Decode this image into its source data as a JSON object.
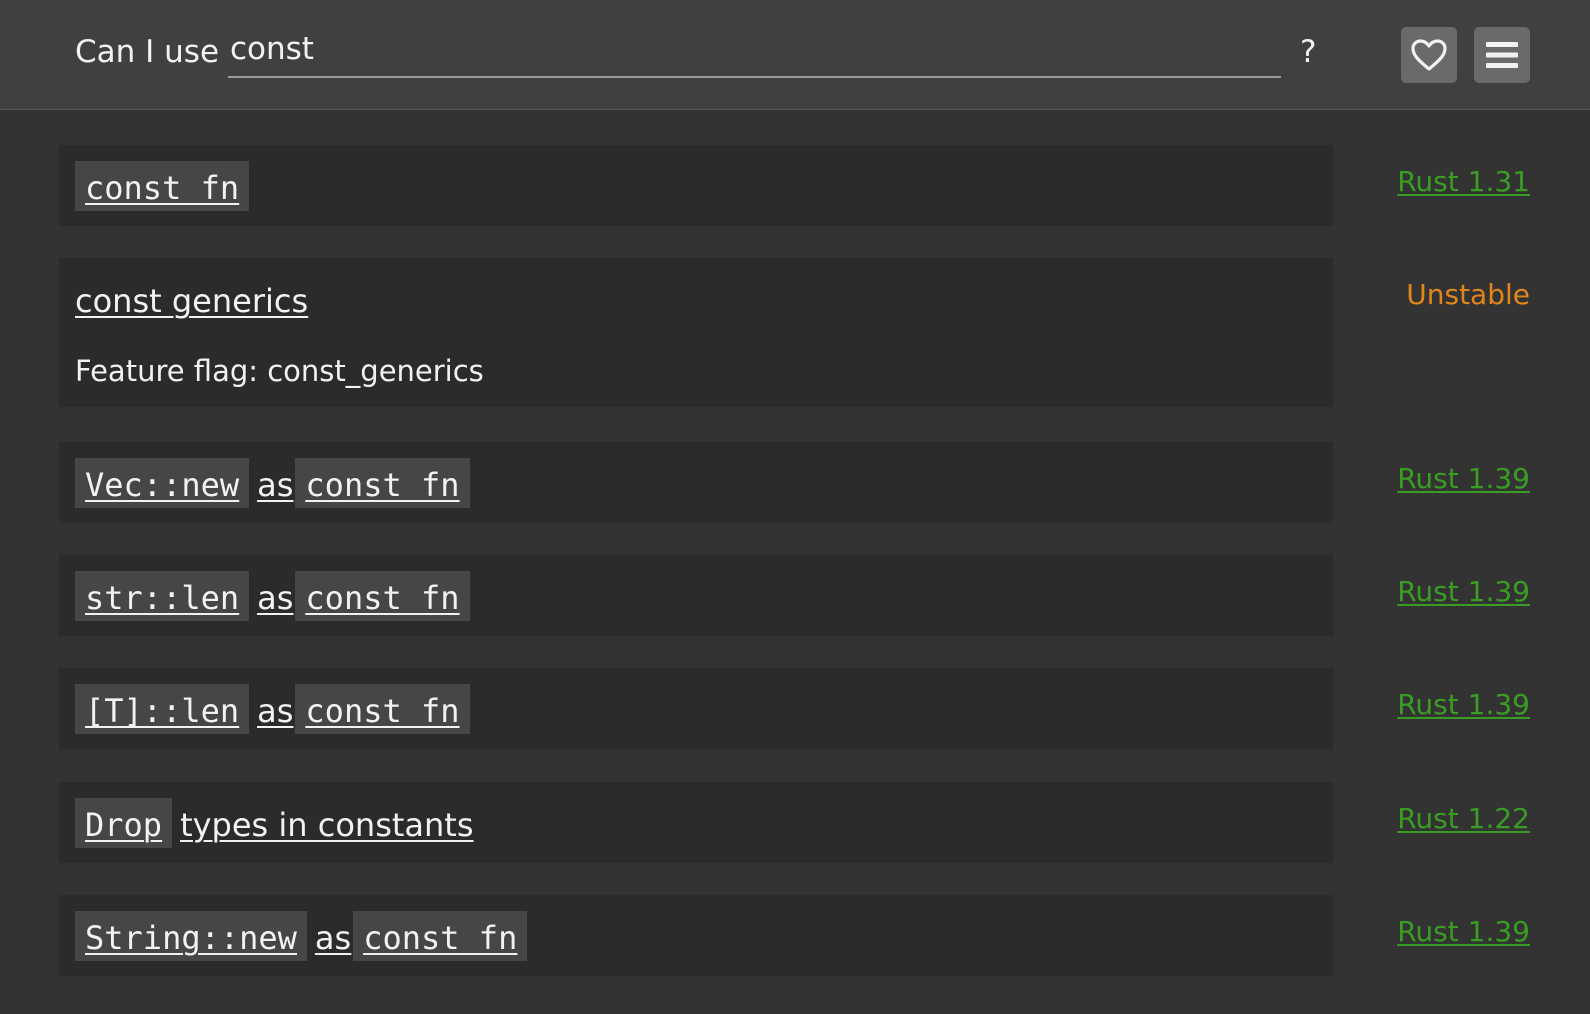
{
  "header": {
    "title": "Can I use",
    "search_value": "const",
    "help_label": "?",
    "favorite_icon": "heart-icon",
    "menu_icon": "hamburger-menu-icon"
  },
  "colors": {
    "stable": "#3a9d23",
    "unstable": "#e0861a",
    "background": "#333333",
    "header": "#404040",
    "card": "#2b2b2b",
    "code_chip": "#464646"
  },
  "features": [
    {
      "parts": [
        {
          "t": "const fn",
          "code": true
        }
      ],
      "version": "Rust 1.31",
      "status": "stable"
    },
    {
      "parts": [
        {
          "t": "const generics",
          "code": false
        }
      ],
      "feature_flag": "Feature flag: const_generics",
      "version": "Unstable",
      "status": "unstable"
    },
    {
      "parts": [
        {
          "t": "Vec::new",
          "code": true
        },
        {
          "t": "as",
          "code": false
        },
        {
          "t": "const fn",
          "code": true
        }
      ],
      "version": "Rust 1.39",
      "status": "stable"
    },
    {
      "parts": [
        {
          "t": "str::len",
          "code": true
        },
        {
          "t": "as",
          "code": false
        },
        {
          "t": "const fn",
          "code": true
        }
      ],
      "version": "Rust 1.39",
      "status": "stable"
    },
    {
      "parts": [
        {
          "t": "[T]::len",
          "code": true
        },
        {
          "t": "as",
          "code": false
        },
        {
          "t": "const fn",
          "code": true
        }
      ],
      "version": "Rust 1.39",
      "status": "stable"
    },
    {
      "parts": [
        {
          "t": "Drop",
          "code": true
        },
        {
          "t": "types in constants",
          "code": false
        }
      ],
      "version": "Rust 1.22",
      "status": "stable"
    },
    {
      "parts": [
        {
          "t": "String::new",
          "code": true
        },
        {
          "t": "as",
          "code": false
        },
        {
          "t": "const fn",
          "code": true
        }
      ],
      "version": "Rust 1.39",
      "status": "stable"
    }
  ]
}
